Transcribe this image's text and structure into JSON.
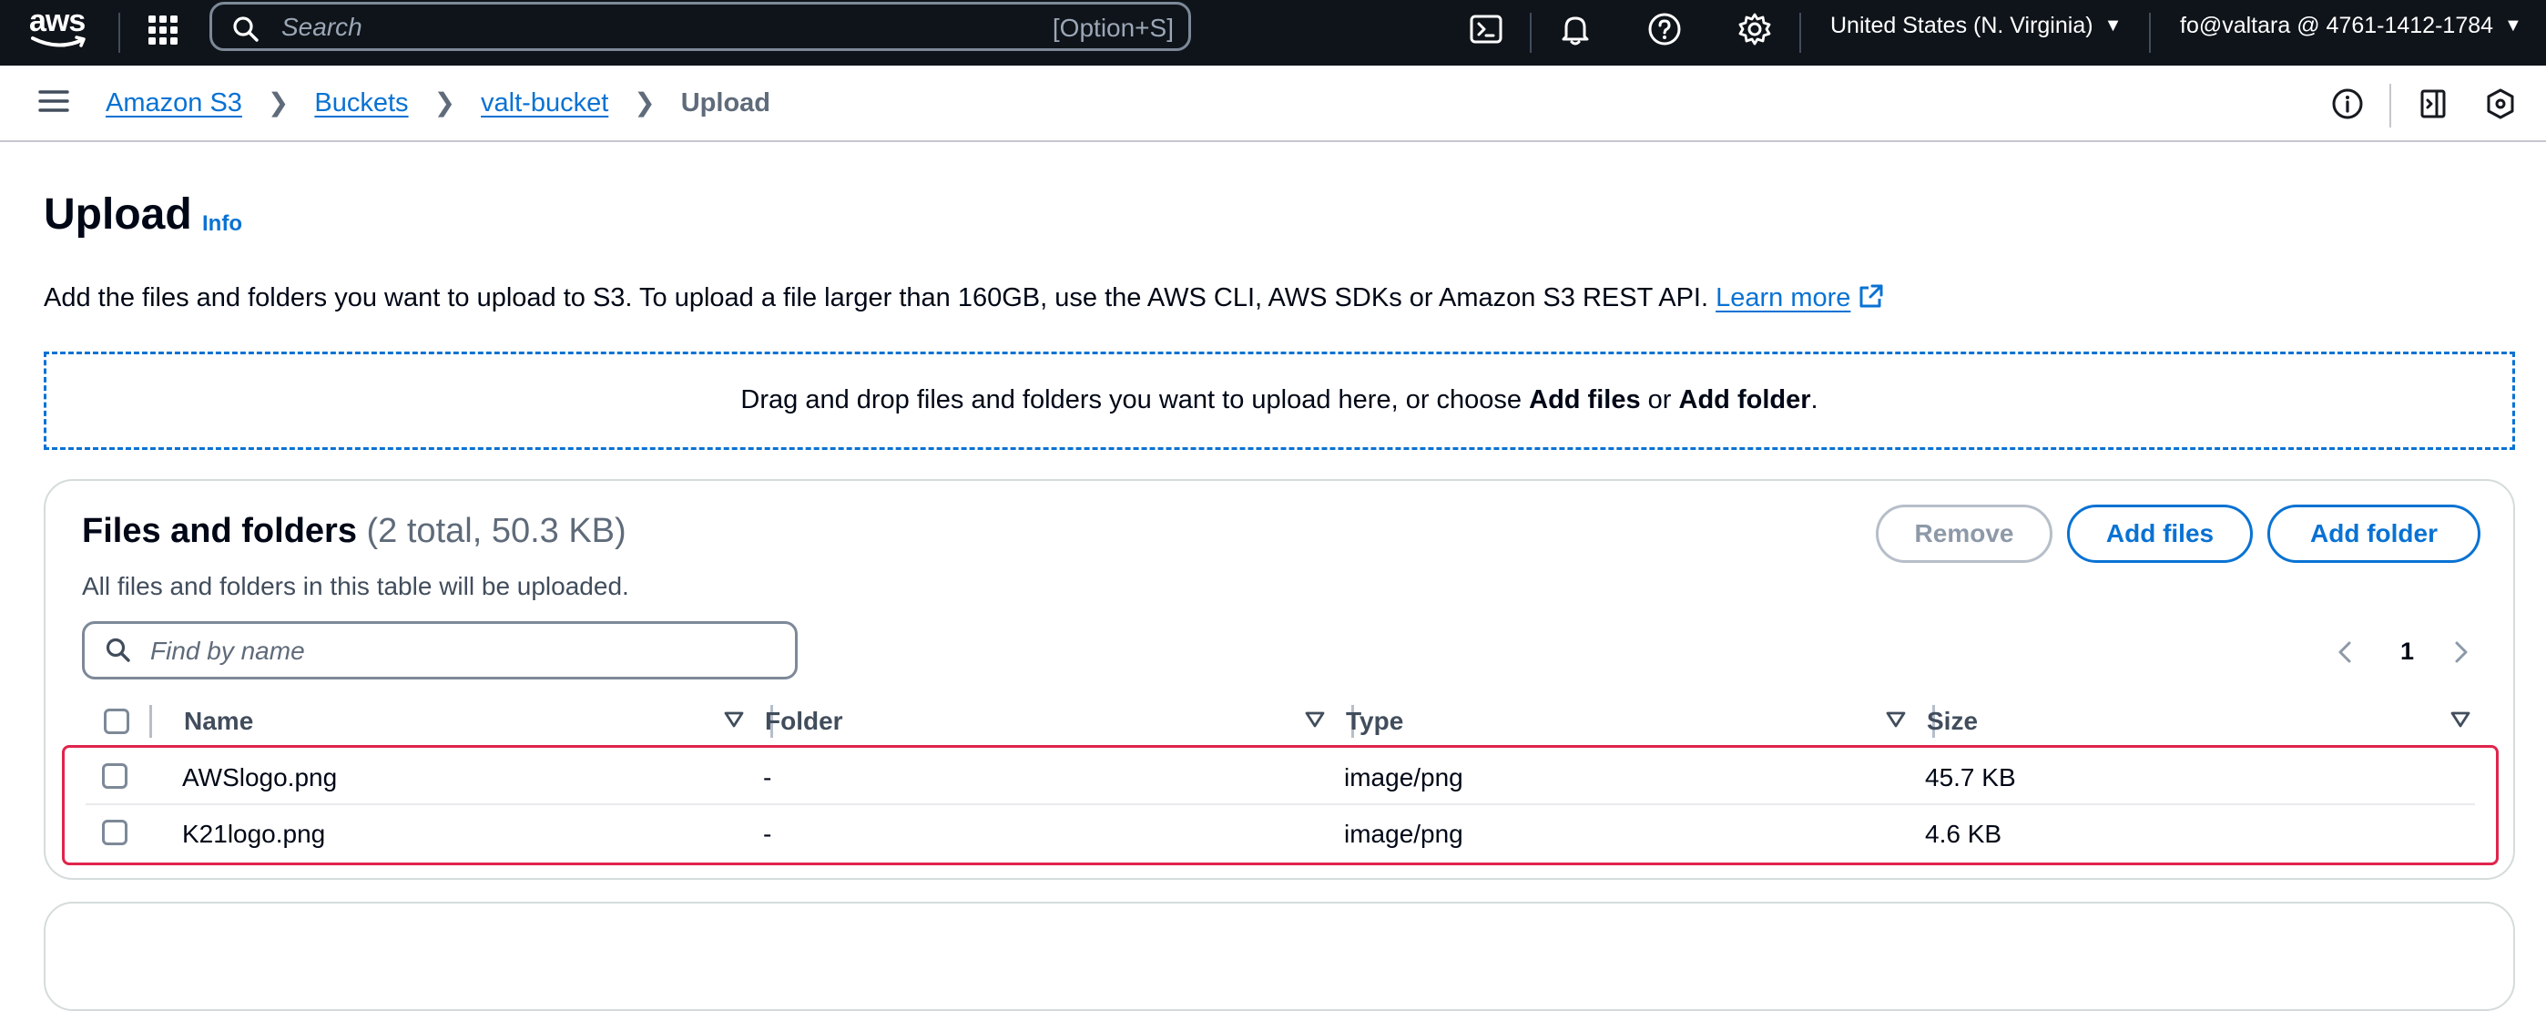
{
  "topnav": {
    "logo_text": "aws",
    "search_placeholder": "Search",
    "search_shortcut": "[Option+S]",
    "region": "United States (N. Virginia)",
    "account": "fo@valtara @ 4761-1412-1784",
    "icons": [
      "grid-icon",
      "search-icon",
      "cloudshell-icon",
      "bell-icon",
      "help-icon",
      "settings-icon"
    ]
  },
  "breadcrumb": {
    "items": [
      "Amazon S3",
      "Buckets",
      "valt-bucket"
    ],
    "current": "Upload",
    "icons": [
      "menu-icon",
      "info-circle-icon",
      "panel-icon",
      "shield-icon"
    ]
  },
  "page": {
    "title": "Upload",
    "info_label": "Info",
    "description": "Add the files and folders you want to upload to S3. To upload a file larger than 160GB, use the AWS CLI, AWS SDKs or Amazon S3 REST API.",
    "learn_more": "Learn more"
  },
  "dropzone": {
    "text_before": "Drag and drop files and folders you want to upload here, or choose",
    "add_files": "Add files",
    "or": "or",
    "add_folder": "Add folder",
    "end": "."
  },
  "files_panel": {
    "title": "Files and folders",
    "counter": "(2 total, 50.3 KB)",
    "subtitle": "All files and folders in this table will be uploaded.",
    "buttons": {
      "remove": "Remove",
      "add_files": "Add files",
      "add_folder": "Add folder"
    },
    "filter_placeholder": "Find by name",
    "pagination": {
      "current_page": "1"
    },
    "columns": [
      "Name",
      "Folder",
      "Type",
      "Size"
    ],
    "rows": [
      {
        "name": "AWSlogo.png",
        "folder": "-",
        "type": "image/png",
        "size": "45.7 KB"
      },
      {
        "name": "K21logo.png",
        "folder": "-",
        "type": "image/png",
        "size": "4.6 KB"
      }
    ]
  },
  "colors": {
    "nav_bg": "#0f141a",
    "link": "#0972d3",
    "selection_border": "#e0244c",
    "text": "#000716"
  }
}
